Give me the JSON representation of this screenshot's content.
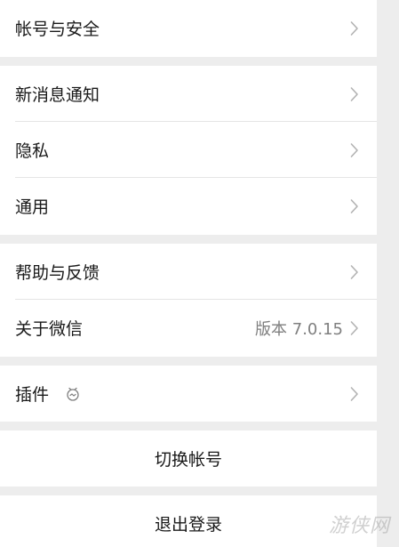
{
  "colors": {
    "page_background": "#ededed",
    "panel_background": "#ffffff",
    "text_primary": "#191919",
    "text_secondary": "#7f7f7f",
    "chevron": "#b2b2b2",
    "divider": "#e5e5e5"
  },
  "settings": {
    "account_security": {
      "label": "帐号与安全"
    },
    "notifications": {
      "label": "新消息通知"
    },
    "privacy": {
      "label": "隐私"
    },
    "general": {
      "label": "通用"
    },
    "help_feedback": {
      "label": "帮助与反馈"
    },
    "about": {
      "label": "关于微信",
      "version": "版本 7.0.15"
    },
    "plugins": {
      "label": "插件",
      "icon": "plugin-icon"
    }
  },
  "actions": {
    "switch_account": "切换帐号",
    "logout": "退出登录"
  },
  "watermark": {
    "text": "游侠网"
  }
}
